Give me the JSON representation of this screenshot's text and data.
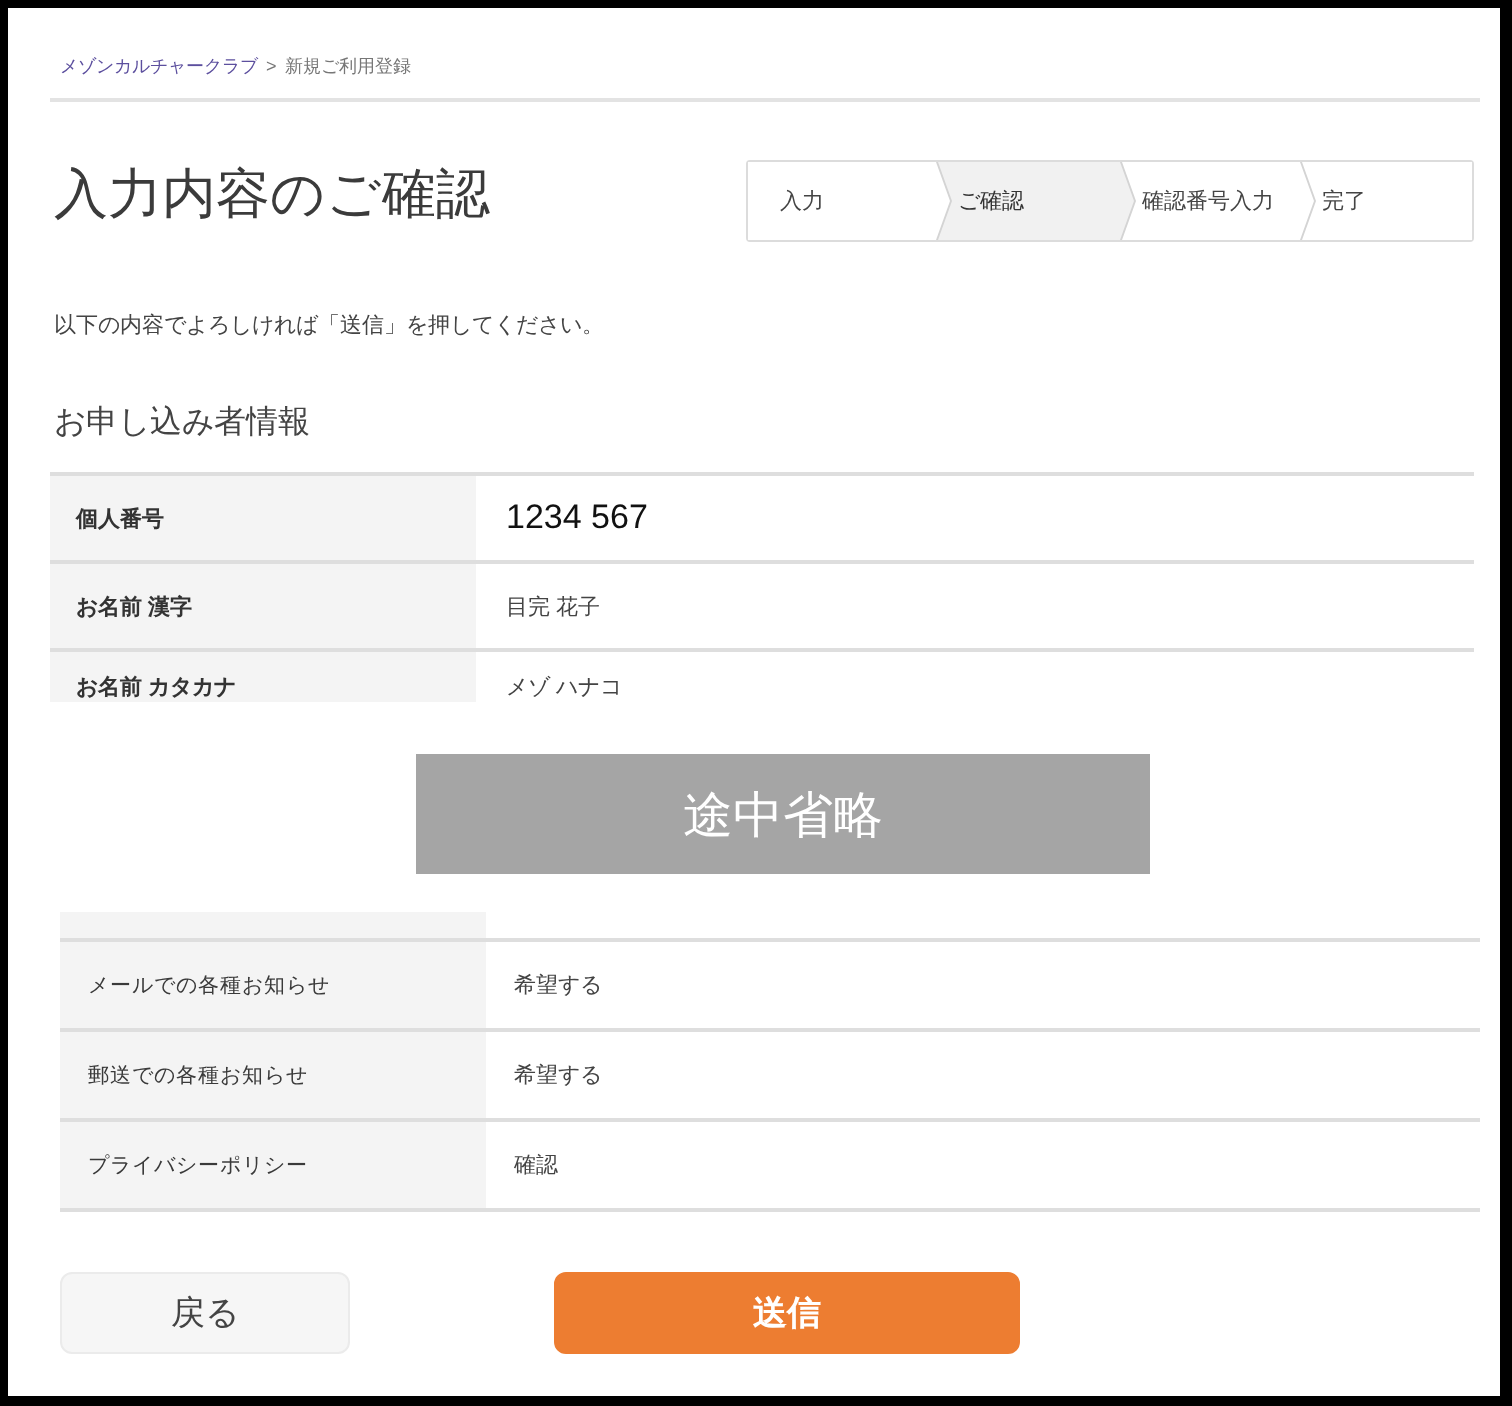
{
  "breadcrumb": {
    "items": [
      {
        "label": "メゾンカルチャークラブ",
        "kind": "link"
      },
      {
        "label": "新規ご利用登録",
        "kind": "current"
      }
    ],
    "separator": ">"
  },
  "title": "入力内容のご確認",
  "steps": [
    {
      "label": "入力",
      "selected": false
    },
    {
      "label": "ご確認",
      "selected": true
    },
    {
      "label": "確認番号入力",
      "selected": false
    },
    {
      "label": "完了",
      "selected": false
    }
  ],
  "instruction": "以下の内容でよろしければ「送信」を押してください。",
  "section_title": "お申し込み者情報",
  "table_upper": {
    "cut_bottom": true,
    "rows": [
      {
        "label": "個人番号",
        "value": "1234 567",
        "kind": "number"
      },
      {
        "label": "お名前 漢字",
        "value": "目完 花子",
        "kind": "text"
      },
      {
        "label": "お名前 カタカナ",
        "value": "メゾ ハナコ",
        "kind": "text"
      }
    ]
  },
  "omission_banner": "途中省略",
  "table_lower": {
    "cut_top": true,
    "rows": [
      {
        "label": "メールでの各種お知らせ",
        "value": "希望する",
        "kind": "text"
      },
      {
        "label": "郵送での各種お知らせ",
        "value": "希望する",
        "kind": "text"
      },
      {
        "label": "プライバシーポリシー",
        "value": "確認",
        "kind": "text"
      }
    ]
  },
  "buttons": [
    {
      "label": "戻る",
      "kind": "secondary"
    },
    {
      "label": "送信",
      "kind": "primary"
    }
  ]
}
